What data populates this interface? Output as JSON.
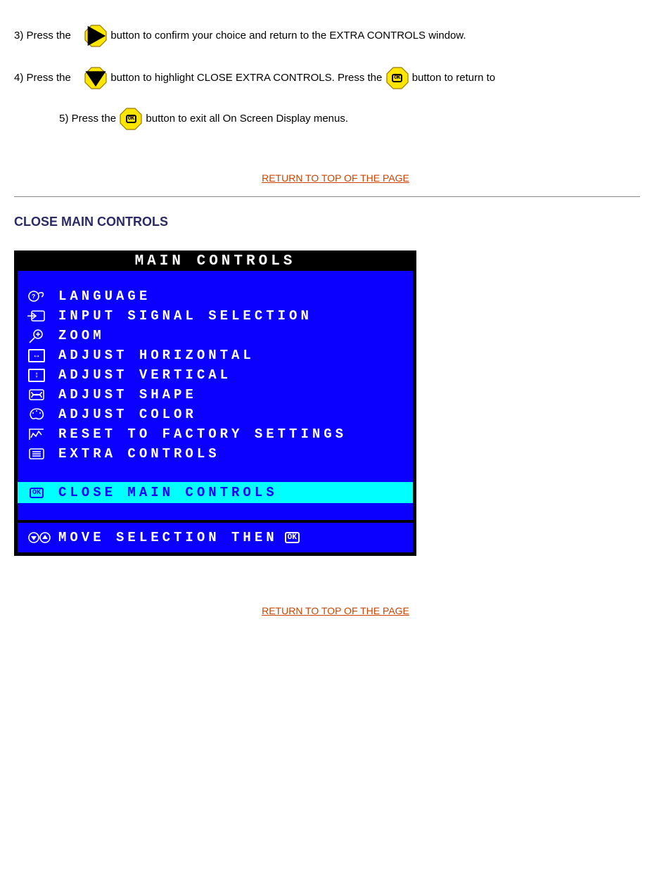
{
  "instructions": {
    "step3_lead": "3) Press the",
    "step3_rest": "button to confirm your choice and return to the EXTRA CONTROLS window.",
    "step4_lead": "4) Press the",
    "step4_rest": "button to highlight CLOSE EXTRA CONTROLS. Press the",
    "step4_rest2": "button to return to",
    "step5_lead": "5) Press the",
    "step5_rest": "button to exit all On Screen Display menus."
  },
  "toplink": "RETURN TO TOP OF THE PAGE",
  "section_title": "CLOSE MAIN CONTROLS",
  "osd": {
    "title": "MAIN CONTROLS",
    "items": [
      {
        "icon": "language-icon",
        "label": "LANGUAGE"
      },
      {
        "icon": "input-icon",
        "label": "INPUT SIGNAL SELECTION"
      },
      {
        "icon": "zoom-icon",
        "label": "ZOOM"
      },
      {
        "icon": "horiz-icon",
        "label": "ADJUST HORIZONTAL"
      },
      {
        "icon": "vert-icon",
        "label": "ADJUST VERTICAL"
      },
      {
        "icon": "shape-icon",
        "label": "ADJUST SHAPE"
      },
      {
        "icon": "color-icon",
        "label": "ADJUST COLOR"
      },
      {
        "icon": "reset-icon",
        "label": "RESET TO FACTORY SETTINGS"
      },
      {
        "icon": "extra-icon",
        "label": "EXTRA CONTROLS"
      }
    ],
    "highlight": {
      "icon": "ok-icon",
      "label": "CLOSE MAIN CONTROLS"
    },
    "footer": {
      "label": "MOVE SELECTION THEN"
    }
  }
}
